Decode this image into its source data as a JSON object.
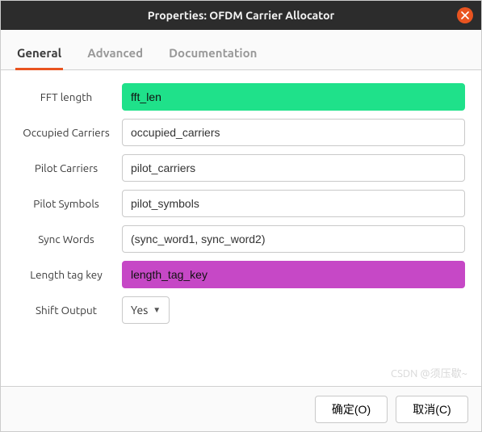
{
  "window": {
    "title": "Properties: OFDM Carrier Allocator"
  },
  "tabs": [
    {
      "label": "General",
      "active": true
    },
    {
      "label": "Advanced",
      "active": false
    },
    {
      "label": "Documentation",
      "active": false
    }
  ],
  "fields": {
    "fft_length": {
      "label": "FFT length",
      "value": "fft_len",
      "style": "green"
    },
    "occupied_carriers": {
      "label": "Occupied Carriers",
      "value": "occupied_carriers",
      "style": "plain"
    },
    "pilot_carriers": {
      "label": "Pilot Carriers",
      "value": "pilot_carriers",
      "style": "plain"
    },
    "pilot_symbols": {
      "label": "Pilot Symbols",
      "value": "pilot_symbols",
      "style": "plain"
    },
    "sync_words": {
      "label": "Sync Words",
      "value": "(sync_word1, sync_word2)",
      "style": "plain"
    },
    "length_tag_key": {
      "label": "Length tag key",
      "value": "length_tag_key",
      "style": "magenta"
    },
    "shift_output": {
      "label": "Shift Output",
      "value": "Yes",
      "style": "select"
    }
  },
  "buttons": {
    "ok": "确定(O)",
    "cancel": "取消(C)"
  },
  "watermark": "CSDN @须压歇~"
}
